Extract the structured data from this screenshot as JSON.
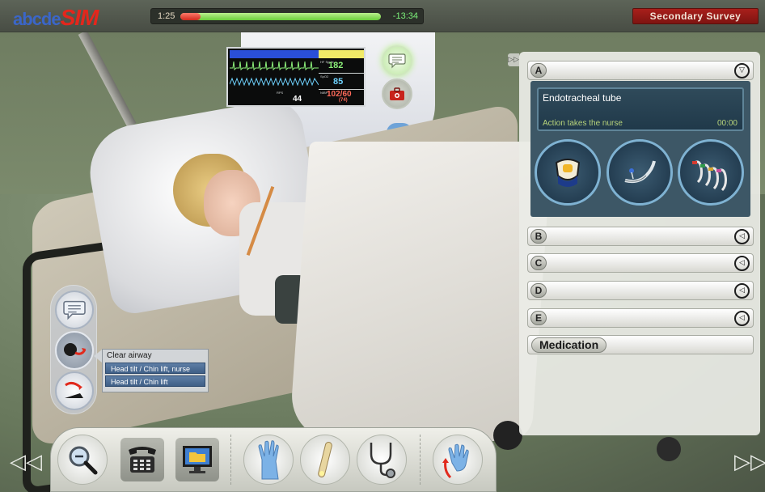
{
  "app": {
    "logo_part1": "abcde",
    "logo_part2": "SIM"
  },
  "timeline": {
    "elapsed": "1:25",
    "remaining": "-13:34",
    "progress": 0.1
  },
  "phase": {
    "label": "Secondary Survey"
  },
  "monitor": {
    "heart_rate": "182",
    "spo2": "85",
    "resp_rate": "44",
    "blood_pressure": "102/60",
    "map": "(74)",
    "labels": {
      "hr": "HF Spule",
      "spo2": "SpO2",
      "rr": "RPS",
      "bp": "NIBP"
    },
    "colors": {
      "hr": "#8cf07a",
      "spo2": "#6fd3ff",
      "bp": "#ff6a5a"
    }
  },
  "left_actions": {
    "buttons": [
      {
        "name": "talk",
        "icon": "speech-bubble-icon"
      },
      {
        "name": "airway",
        "icon": "head-tilt-icon",
        "active": true
      },
      {
        "name": "reposition",
        "icon": "turn-patient-icon"
      }
    ],
    "popup": {
      "title": "Clear airway",
      "options": [
        "Head tilt / Chin lift, nurse",
        "Head tilt / Chin lift"
      ]
    }
  },
  "toolbar": {
    "tools": [
      {
        "name": "zoom",
        "icon": "magnifier-icon"
      },
      {
        "name": "phone",
        "icon": "telephone-icon"
      },
      {
        "name": "records",
        "icon": "computer-folder-icon"
      },
      {
        "name": "examine",
        "icon": "glove-icon"
      },
      {
        "name": "light",
        "icon": "penlight-icon"
      },
      {
        "name": "auscultate",
        "icon": "stethoscope-icon"
      },
      {
        "name": "turn",
        "icon": "rotate-hand-icon"
      }
    ]
  },
  "nav": {
    "prev": "◁◁",
    "next": "▷▷"
  },
  "panel": {
    "toggle": "▷▷",
    "sections": [
      {
        "letter": "A",
        "expanded": true
      },
      {
        "letter": "B",
        "expanded": false
      },
      {
        "letter": "C",
        "expanded": false
      },
      {
        "letter": "D",
        "expanded": false
      },
      {
        "letter": "E",
        "expanded": false
      }
    ],
    "expanded_caret": "▽",
    "collapsed_caret": "◁",
    "medication_label": "Medication",
    "current_action": {
      "title": "Endotracheal tube",
      "status": "Action takes the nurse",
      "time": "00:00"
    },
    "equipment": [
      {
        "name": "cervical-collar",
        "icon": "cervical-collar-icon"
      },
      {
        "name": "endotracheal-tube",
        "icon": "endotracheal-tube-icon"
      },
      {
        "name": "guedel-airways",
        "icon": "guedel-airway-icon"
      }
    ]
  }
}
